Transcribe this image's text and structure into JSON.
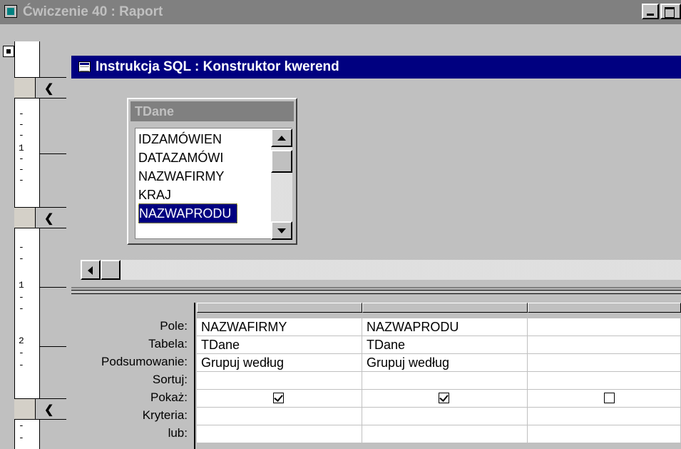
{
  "outer_window": {
    "title": "Ćwiczenie 40 : Raport"
  },
  "ruler": {
    "marks": [
      "-",
      "-",
      "-",
      "1",
      "-",
      "-",
      "-",
      "-",
      "-",
      "1",
      "-",
      "-",
      "2",
      "-",
      "-",
      "-",
      "-"
    ]
  },
  "query_window": {
    "title": "Instrukcja SQL : Konstruktor kwerend",
    "table": {
      "name": "TDane",
      "fields": [
        "IDZAMÓWIEN",
        "DATAZAMÓWI",
        "NAZWAFIRMY",
        "KRAJ",
        "NAZWAPRODU"
      ],
      "selected_field": "NAZWAPRODU"
    },
    "grid": {
      "row_labels": {
        "pole": "Pole:",
        "tabela": "Tabela:",
        "podsumowanie": "Podsumowanie:",
        "sortuj": "Sortuj:",
        "pokaz": "Pokaż:",
        "kryteria": "Kryteria:",
        "lub": "lub:"
      },
      "columns": [
        {
          "pole": "NAZWAFIRMY",
          "tabela": "TDane",
          "podsumowanie": "Grupuj według",
          "sortuj": "",
          "pokaz": true,
          "kryteria": "",
          "lub": ""
        },
        {
          "pole": "NAZWAPRODU",
          "tabela": "TDane",
          "podsumowanie": "Grupuj według",
          "sortuj": "",
          "pokaz": true,
          "kryteria": "",
          "lub": ""
        },
        {
          "pole": "",
          "tabela": "",
          "podsumowanie": "",
          "sortuj": "",
          "pokaz": false,
          "kryteria": "",
          "lub": ""
        }
      ]
    }
  },
  "icons": {
    "outer_window_icon": "report-icon",
    "query_window_icon": "query-design-icon"
  },
  "colors": {
    "active_title": "#000080",
    "inactive_title": "#808080",
    "face": "#c0c0c0"
  }
}
